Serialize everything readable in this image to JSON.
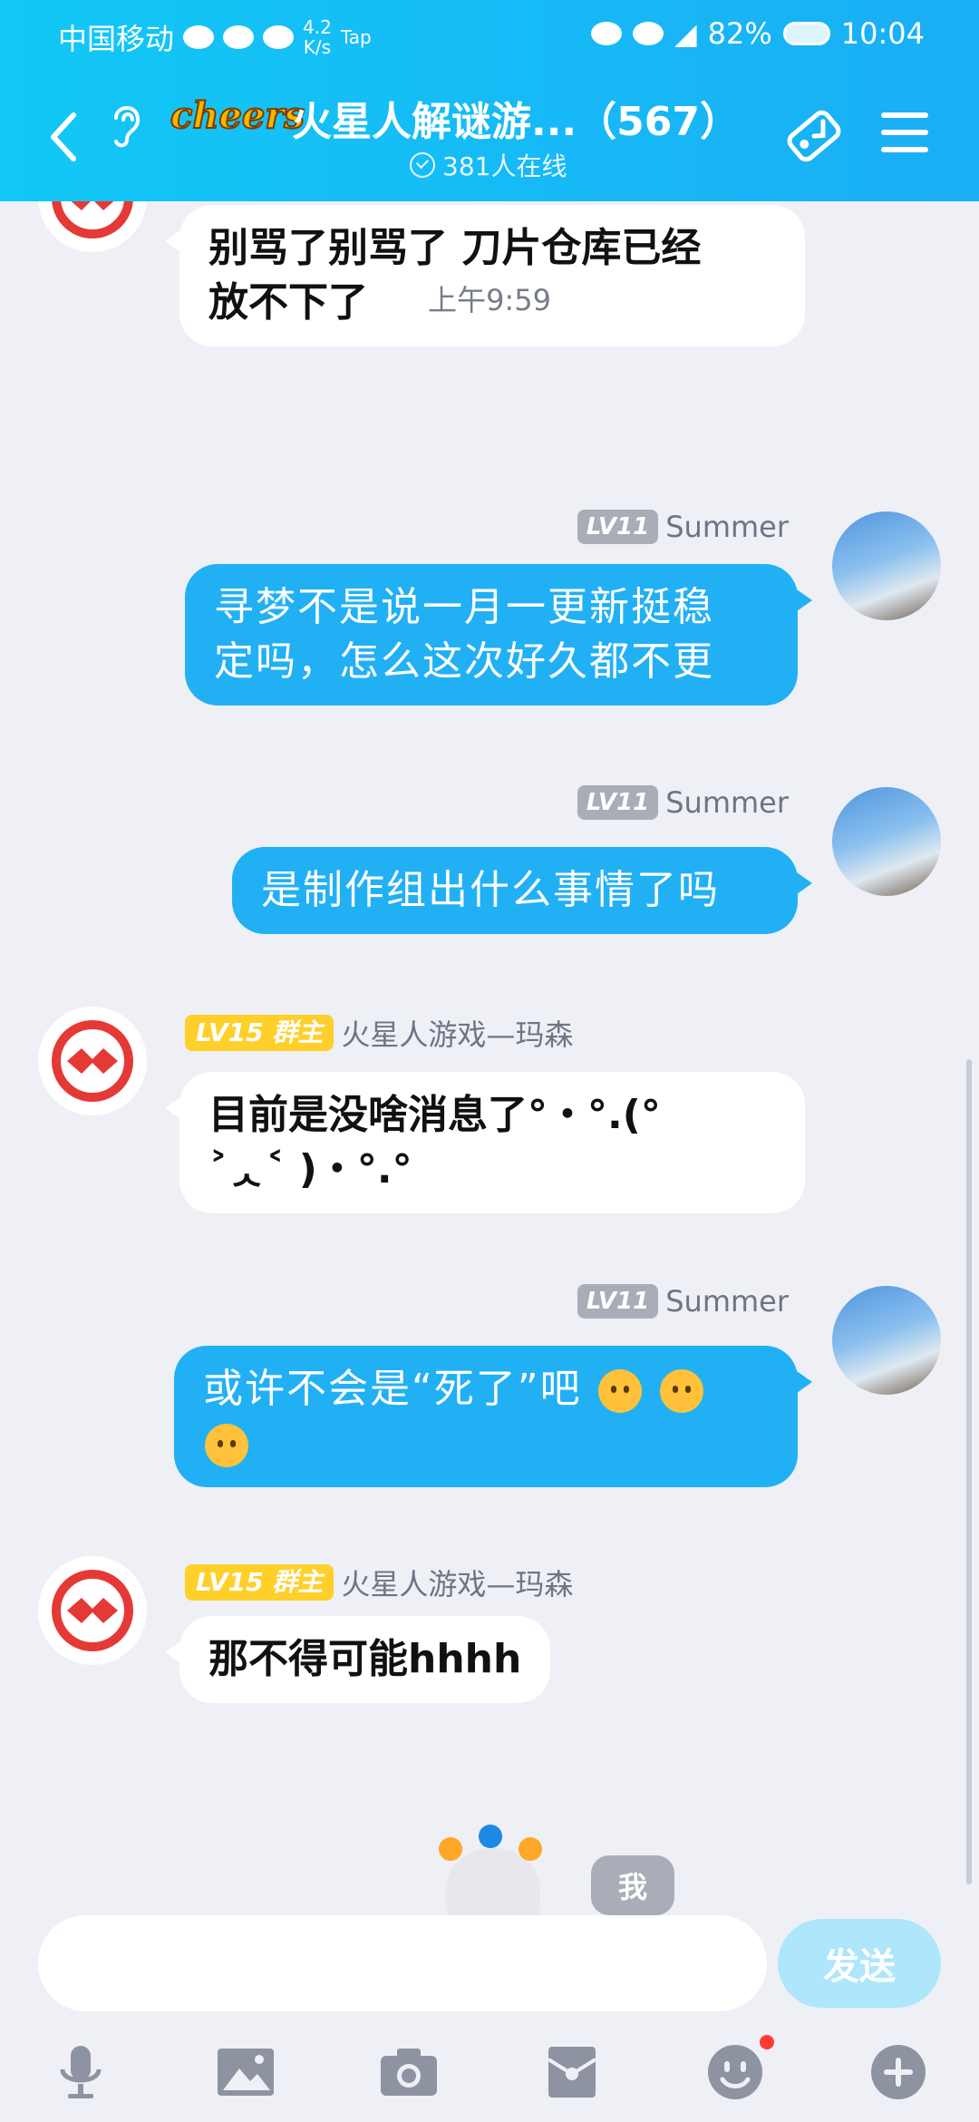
{
  "status_bar": {
    "carrier": "中国移动",
    "net_speed_value": "4.2",
    "net_speed_unit": "K/s",
    "app_tag": "Tap",
    "battery": "82%",
    "time": "10:04"
  },
  "header": {
    "logo_text": "cheers",
    "title": "火星人解谜游...（567）",
    "online_count": "381人在线"
  },
  "messages": [
    {
      "type": "incoming",
      "text_line1": "别骂了别骂了  刀片仓库已经",
      "text_line2": "放不下了"
    },
    {
      "type": "timestamp",
      "text": "上午9:59"
    },
    {
      "type": "outgoing",
      "level": "LV11",
      "sender": "Summer",
      "text_line1": "寻梦不是说一月一更新挺稳",
      "text_line2": "定吗，怎么这次好久都不更"
    },
    {
      "type": "outgoing",
      "level": "LV11",
      "sender": "Summer",
      "text_line1": "是制作组出什么事情了吗"
    },
    {
      "type": "incoming",
      "level": "LV15",
      "role": "群主",
      "sender": "火星人游戏—玛森",
      "text_line1": "目前是没啥消息了°・°.(°",
      "text_line2": "˃ᆺ˂ )・°.°"
    },
    {
      "type": "outgoing",
      "level": "LV11",
      "sender": "Summer",
      "text_line1": "或许不会是“死了”吧"
    },
    {
      "type": "incoming",
      "level": "LV15",
      "role": "群主",
      "sender": "火星人游戏—玛森",
      "text_line1": "那不得可能hhhh"
    }
  ],
  "self_badge": "我",
  "composer": {
    "input_value": "",
    "send_label": "发送"
  },
  "toolbar_icons": [
    "microphone-icon",
    "image-icon",
    "camera-icon",
    "red-packet-icon",
    "emoji-icon",
    "plus-icon"
  ],
  "colors": {
    "header_gradient_start": "#12c8f6",
    "header_gradient_end": "#1aaef5",
    "outgoing_bubble": "#22b0f4",
    "owner_badge": "#ffcf2a",
    "level_badge": "#a9adb8",
    "background": "#eef0f6"
  }
}
